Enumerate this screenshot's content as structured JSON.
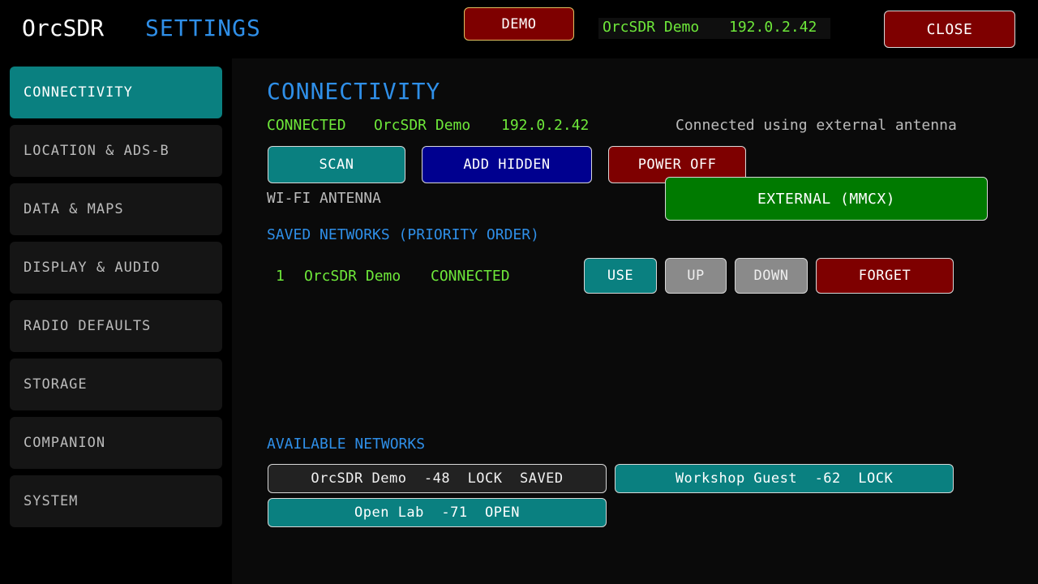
{
  "header": {
    "app_name": "OrcSDR",
    "page_title": "SETTINGS",
    "demo_label": "DEMO",
    "device_name": "OrcSDR Demo",
    "device_ip": "192.0.2.42",
    "close_label": "CLOSE"
  },
  "sidebar": {
    "items": [
      {
        "label": "CONNECTIVITY",
        "active": true
      },
      {
        "label": "LOCATION & ADS-B"
      },
      {
        "label": "DATA & MAPS"
      },
      {
        "label": "DISPLAY & AUDIO"
      },
      {
        "label": "RADIO DEFAULTS"
      },
      {
        "label": "STORAGE"
      },
      {
        "label": "COMPANION"
      },
      {
        "label": "SYSTEM"
      }
    ]
  },
  "main": {
    "section_title": "CONNECTIVITY",
    "status": "CONNECTED",
    "network": "OrcSDR Demo",
    "ip": "192.0.2.42",
    "antenna_status": "Connected using external antenna",
    "scan_label": "SCAN",
    "add_hidden_label": "ADD HIDDEN",
    "power_off_label": "POWER OFF",
    "antenna_label": "WI-FI ANTENNA",
    "antenna_option": "EXTERNAL (MMCX)",
    "saved_title": "SAVED NETWORKS (PRIORITY ORDER)",
    "saved": [
      {
        "index": "1",
        "name": "OrcSDR Demo",
        "status": "CONNECTED"
      }
    ],
    "use_label": "USE",
    "up_label": "UP",
    "down_label": "DOWN",
    "forget_label": "FORGET",
    "available_title": "AVAILABLE NETWORKS",
    "available": [
      {
        "label": "OrcSDR Demo  -48  LOCK  SAVED"
      },
      {
        "label": "Workshop Guest  -62  LOCK"
      },
      {
        "label": "Open Lab  -71  OPEN"
      }
    ]
  },
  "colors": {
    "accent_blue": "#2f8fe8",
    "status_green": "#6ee83a",
    "teal": "#0a8080",
    "red": "#7e0000"
  }
}
